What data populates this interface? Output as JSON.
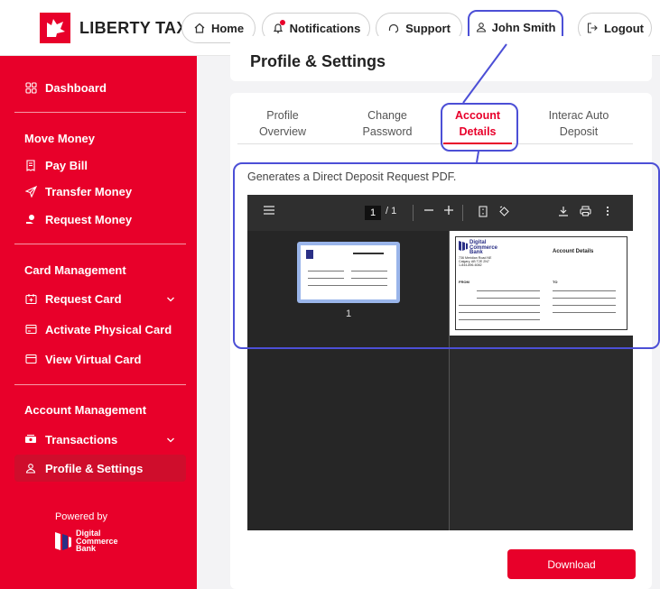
{
  "brand": {
    "name": "LIBERTY TAX",
    "accent": "#e8002a",
    "annotation_color": "#4c4fd6"
  },
  "nav": {
    "home": "Home",
    "notifications": "Notifications",
    "support": "Support",
    "user": "John Smith",
    "logout": "Logout"
  },
  "sidebar": {
    "dashboard": "Dashboard",
    "move_money": {
      "title": "Move Money",
      "items": [
        "Pay Bill",
        "Transfer Money",
        "Request Money"
      ]
    },
    "card_management": {
      "title": "Card Management",
      "items": [
        "Request Card",
        "Activate Physical Card",
        "View Virtual Card"
      ]
    },
    "account_management": {
      "title": "Account Management",
      "items": [
        "Transactions",
        "Profile & Settings"
      ]
    },
    "powered_by": "Powered by",
    "partner": {
      "line1": "Digital",
      "line2": "Commerce",
      "line3": "Bank"
    }
  },
  "main": {
    "title": "Profile & Settings",
    "tabs": [
      {
        "line1": "Profile",
        "line2": "Overview"
      },
      {
        "line1": "Change",
        "line2": "Password"
      },
      {
        "line1": "Account",
        "line2": "Details"
      },
      {
        "line1": "Interac Auto",
        "line2": "Deposit"
      }
    ],
    "description": "Generates a Direct Deposit Request PDF.",
    "pdf": {
      "page_current": "1",
      "page_total": "/ 1",
      "thumb_number": "1",
      "doc_title": "Account Details",
      "doc_bank": {
        "line1": "Digital",
        "line2": "Commerce",
        "line3": "Bank"
      },
      "doc_address": [
        "736 Meridian Road NE",
        "Calgary, AB T2E 2N7",
        "1-844-896-6082"
      ],
      "doc_from": "FROM",
      "doc_to": "TO"
    },
    "download": "Download"
  }
}
